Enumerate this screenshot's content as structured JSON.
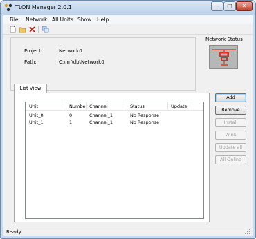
{
  "window": {
    "title": "TLON Manager 2.0.1",
    "min_glyph": "–",
    "max_glyph": "□",
    "close_glyph": "✕"
  },
  "menu": {
    "file": "File",
    "network": "Network",
    "all_units": "All Units",
    "show": "Show",
    "help": "Help"
  },
  "toolbar": {
    "new_icon": "new-document-icon",
    "open_icon": "open-folder-icon",
    "delete_icon": "delete-x-icon",
    "copy_icon": "copy-icon"
  },
  "info": {
    "project_label": "Project:",
    "project_value": "Network0",
    "path_label": "Path:",
    "path_value": "C:\\lm\\db\\Network0"
  },
  "network_status": {
    "label": "Network Status",
    "icon": "network-node-icon",
    "icon_color": "#e03020"
  },
  "tabs": {
    "list_view": "List View"
  },
  "listview": {
    "columns": [
      "Unit",
      "Number",
      "Channel",
      "Status",
      "Update"
    ],
    "rows": [
      {
        "unit": "Unit_0",
        "number": "0",
        "channel": "Channel_1",
        "status": "No Response",
        "update": ""
      },
      {
        "unit": "Unit_1",
        "number": "1",
        "channel": "Channel_1",
        "status": "No Response",
        "update": ""
      }
    ]
  },
  "buttons": {
    "add": "Add",
    "remove": "Remove",
    "install": "Install",
    "wink": "Wink",
    "update_all": "Update all",
    "all_online": "All Online"
  },
  "statusbar": {
    "text": "Ready"
  }
}
